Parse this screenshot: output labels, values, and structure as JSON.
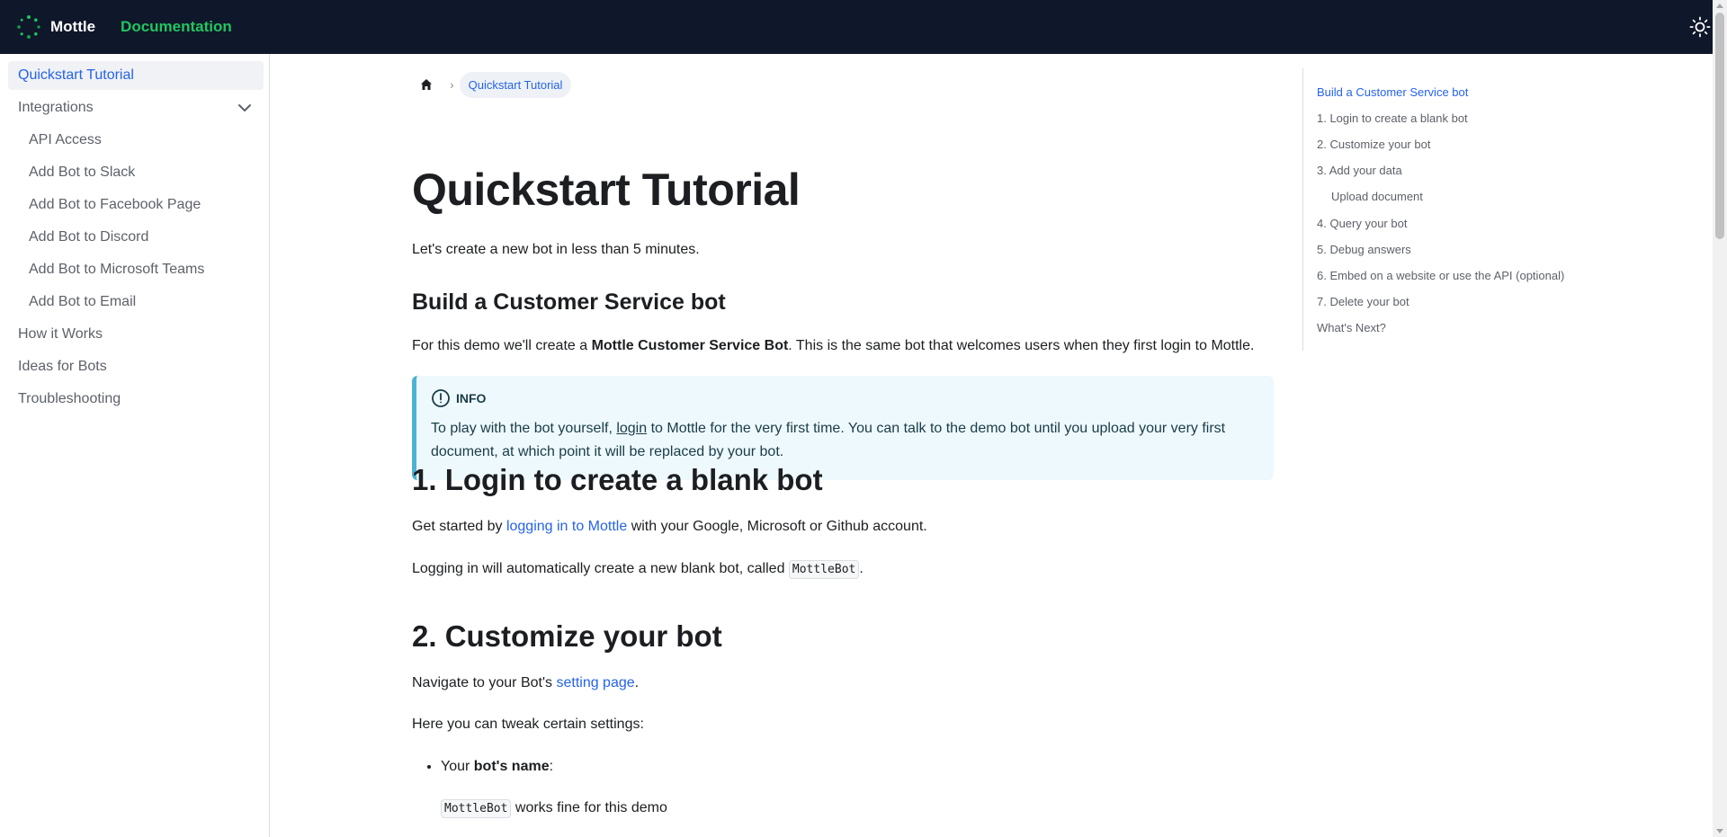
{
  "navbar": {
    "brand": "Mottle",
    "doc_link": "Documentation"
  },
  "sidebar": {
    "items": [
      {
        "label": "Quickstart Tutorial"
      },
      {
        "label": "Integrations"
      },
      {
        "label": "API Access"
      },
      {
        "label": "Add Bot to Slack"
      },
      {
        "label": "Add Bot to Facebook Page"
      },
      {
        "label": "Add Bot to Discord"
      },
      {
        "label": "Add Bot to Microsoft Teams"
      },
      {
        "label": "Add Bot to Email"
      },
      {
        "label": "How it Works"
      },
      {
        "label": "Ideas for Bots"
      },
      {
        "label": "Troubleshooting"
      }
    ]
  },
  "breadcrumb": {
    "current": "Quickstart Tutorial"
  },
  "content": {
    "title": "Quickstart Tutorial",
    "intro": "Let's create a new bot in less than 5 minutes.",
    "section1_title": "Build a Customer Service bot",
    "demo_pre": "For this demo we'll create a ",
    "demo_bold": "Mottle Customer Service Bot",
    "demo_post": ". This is the same bot that welcomes users when they first login to Mottle.",
    "info_label": "INFO",
    "info_pre": "To play with the bot yourself, ",
    "info_link": "login",
    "info_post_line1": " to Mottle for the very first time. You can talk to the demo bot until you upload your very first",
    "info_line2": "document, at which point it will be replaced by your bot.",
    "step1_title": "1. Login to create a blank bot",
    "step1_pre": "Get started by ",
    "step1_link": "logging in to Mottle",
    "step1_post": " with your Google, Microsoft or Github account.",
    "step1b_pre": "Logging in will automatically create a new blank bot, called ",
    "step1b_code": "MottleBot",
    "step1b_post": ".",
    "step2_title": "2. Customize your bot",
    "step2_pre": "Navigate to your Bot's ",
    "step2_link": "setting page",
    "step2_post": ".",
    "step2b": "Here you can tweak certain settings:",
    "bullet_pre": "Your ",
    "bullet_bold": "bot's name",
    "bullet_post": ":",
    "bullet_sub_code": "MottleBot",
    "bullet_sub_post": " works fine for this demo"
  },
  "toc": {
    "items": [
      {
        "label": "Build a Customer Service bot"
      },
      {
        "label": "1. Login to create a blank bot"
      },
      {
        "label": "2. Customize your bot"
      },
      {
        "label": "3. Add your data"
      },
      {
        "label": "Upload document"
      },
      {
        "label": "4. Query your bot"
      },
      {
        "label": "5. Debug answers"
      },
      {
        "label": "6. Embed on a website or use the API (optional)"
      },
      {
        "label": "7. Delete your bot"
      },
      {
        "label": "What's Next?"
      }
    ]
  },
  "colors": {
    "navbar_bg": "#0f172a",
    "accent_green": "#22c55e",
    "link_blue": "#2563eb",
    "info_bg": "#eef9fd",
    "info_border": "#4cb3d4"
  },
  "icons": {
    "logo": "mottle-logo-icon",
    "theme": "sun-icon",
    "home": "home-icon",
    "chevron": "chevron-down-icon",
    "info": "info-circle-icon"
  }
}
